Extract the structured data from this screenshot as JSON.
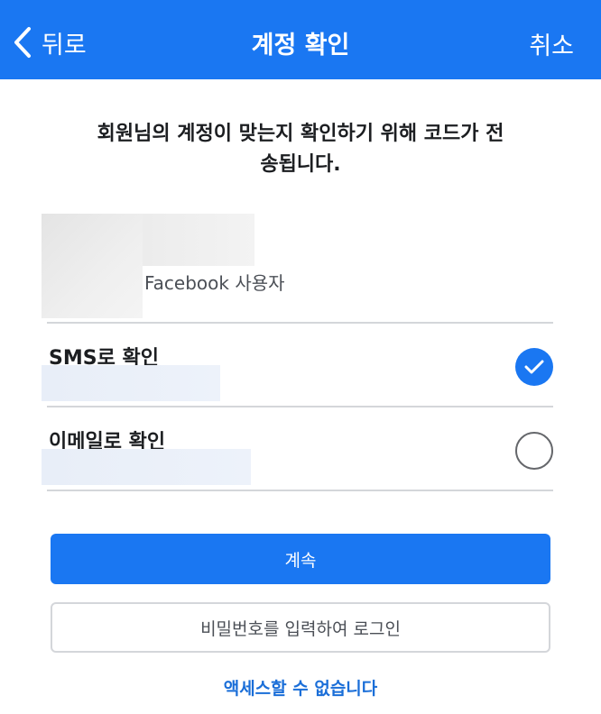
{
  "header": {
    "back_label": "뒤로",
    "title": "계정 확인",
    "cancel_label": "취소",
    "background": "#1a77f2"
  },
  "description": {
    "line1": "회원님의 계정이 맞는지 확인하기 위해 코드가 전",
    "line2": "송됩니다."
  },
  "profile": {
    "username": "Facebook 사용자"
  },
  "options": [
    {
      "label": "SMS로 확인",
      "selected": true,
      "icon": "checkmark-icon"
    },
    {
      "label": "이메일로 확인",
      "selected": false,
      "icon": "radio-empty-icon"
    }
  ],
  "buttons": {
    "continue_label": "계속",
    "password_login_label": "비밀번호를 입력하여 로그인",
    "no_access_label": "액세스할 수 없습니다"
  },
  "colors": {
    "accent": "#1a77f2",
    "link": "#1a6ed8",
    "divider": "#d4d6da"
  }
}
